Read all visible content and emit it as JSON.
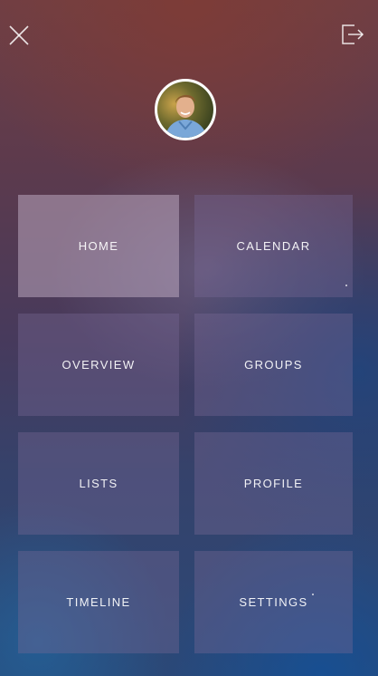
{
  "menu": {
    "tiles": [
      {
        "label": "HOME",
        "active": true
      },
      {
        "label": "CALENDAR",
        "active": false
      },
      {
        "label": "OVERVIEW",
        "active": false
      },
      {
        "label": "GROUPS",
        "active": false
      },
      {
        "label": "LISTS",
        "active": false
      },
      {
        "label": "PROFILE",
        "active": false
      },
      {
        "label": "TIMELINE",
        "active": false
      },
      {
        "label": "SETTINGS",
        "active": false
      }
    ]
  },
  "icons": {
    "close": "close-icon",
    "logout": "logout-icon",
    "avatar": "user-avatar-photo"
  },
  "colors": {
    "top": "#6f3f45",
    "bottom": "#2b4877",
    "tile": "#786996",
    "tile_active": "#b9a5be"
  }
}
